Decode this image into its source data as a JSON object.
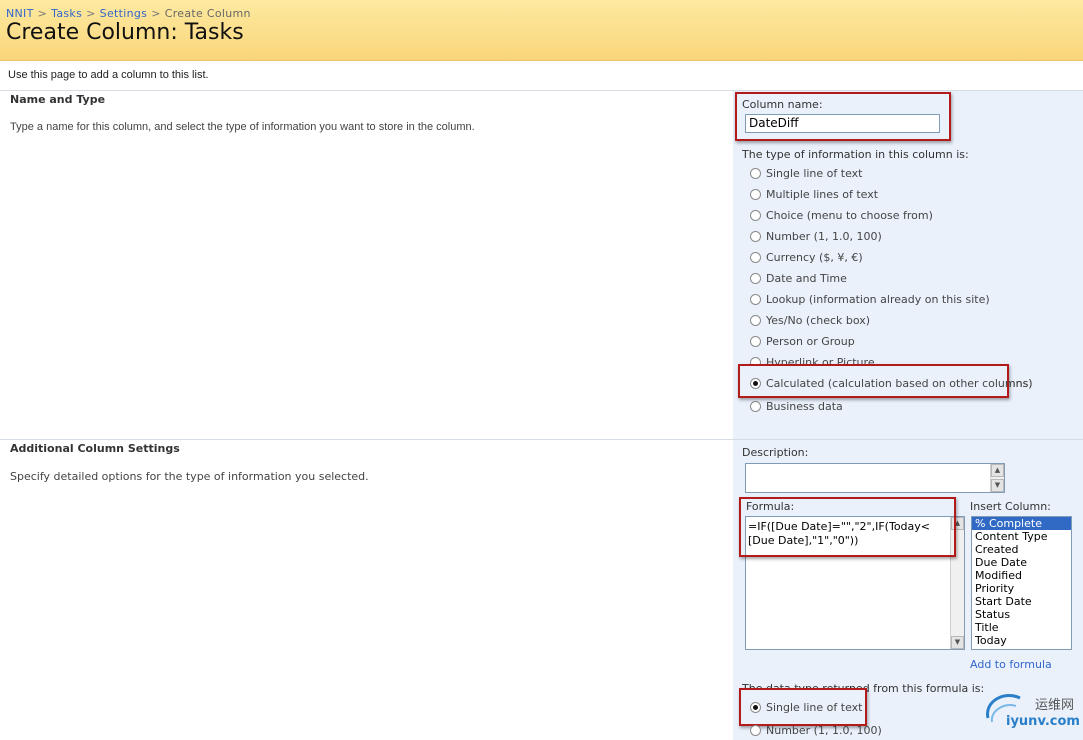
{
  "breadcrumb": [
    "NNIT",
    "Tasks",
    "Settings",
    "Create Column"
  ],
  "breadcrumb_sep": ">",
  "page_title": "Create Column: Tasks",
  "intro": "Use this page to add a column to this list.",
  "name_type_section": {
    "title": "Name and Type",
    "description": "Type a name for this column, and select the type of information you want to store in the column.",
    "column_name_label": "Column name:",
    "column_name_value": "DateDiff",
    "type_label": "The type of information in this column is:",
    "types": [
      {
        "label": "Single line of text",
        "checked": false
      },
      {
        "label": "Multiple lines of text",
        "checked": false
      },
      {
        "label": "Choice (menu to choose from)",
        "checked": false
      },
      {
        "label": "Number (1, 1.0, 100)",
        "checked": false
      },
      {
        "label": "Currency ($, ¥, €)",
        "checked": false
      },
      {
        "label": "Date and Time",
        "checked": false
      },
      {
        "label": "Lookup (information already on this site)",
        "checked": false
      },
      {
        "label": "Yes/No (check box)",
        "checked": false
      },
      {
        "label": "Person or Group",
        "checked": false
      },
      {
        "label": "Hyperlink or Picture",
        "checked": false
      },
      {
        "label": "Calculated (calculation based on other columns)",
        "checked": true
      },
      {
        "label": "Business data",
        "checked": false
      }
    ]
  },
  "additional_section": {
    "title": "Additional Column Settings",
    "description": "Specify detailed options for the type of information you selected.",
    "description_label": "Description:",
    "formula_label": "Formula:",
    "formula_line1": "=IF([Due Date]=\"\",\"2\",IF(Today<",
    "formula_line2": "[Due Date],\"1\",\"0\"))",
    "insert_column_label": "Insert Column:",
    "insert_columns": [
      "% Complete",
      "Content Type",
      "Created",
      "Due Date",
      "Modified",
      "Priority",
      "Start Date",
      "Status",
      "Title",
      "Today"
    ],
    "selected_insert_column": "% Complete",
    "add_to_formula": "Add to formula",
    "return_type_label": "The data type returned from this formula is:",
    "return_types": [
      {
        "label": "Single line of text",
        "checked": true
      },
      {
        "label": "Number (1, 1.0, 100)",
        "checked": false
      }
    ]
  },
  "watermark": {
    "cn": "运维网",
    "en": "iyunv.com"
  },
  "colors": {
    "header_bg": "#fbdc86",
    "panel_bg": "#eaf1fb",
    "highlight_border": "#b31b1b",
    "link": "#3366cc"
  }
}
